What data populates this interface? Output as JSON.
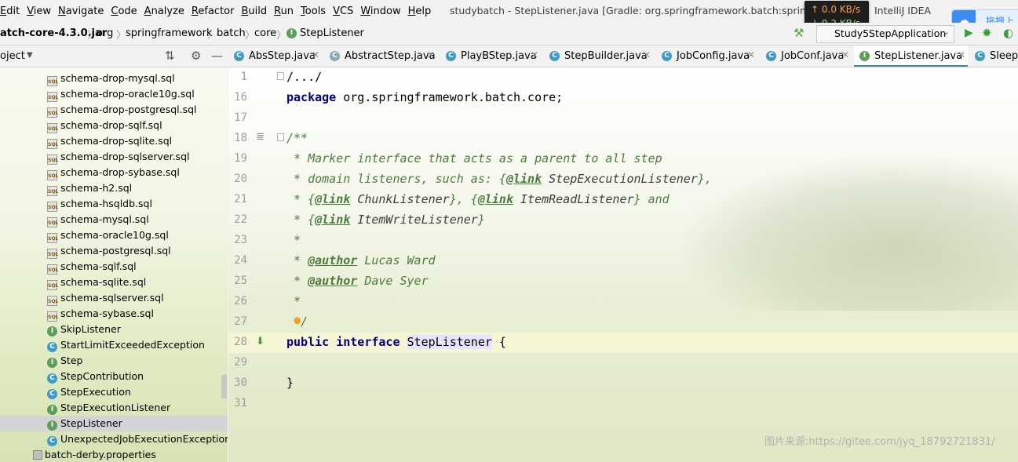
{
  "menu": [
    "Edit",
    "View",
    "Navigate",
    "Code",
    "Analyze",
    "Refactor",
    "Build",
    "Run",
    "Tools",
    "VCS",
    "Window",
    "Help"
  ],
  "window_title": "studybatch - StepListener.java [Gradle: org.springframework.batch:spring-batch",
  "app_name": "IntelliJ IDEA",
  "netspeed": {
    "up": "↑ 0.0 KB/s",
    "down": "↓ 0.2 KB/s"
  },
  "baidu_label": "拖拽上传",
  "breadcrumb": {
    "jar": "atch-core-4.3.0.jar",
    "items": [
      "org",
      "springframework",
      "batch",
      "core",
      "StepListener"
    ]
  },
  "run_config": "Study5StepApplication",
  "project_header": "oject",
  "tabs": [
    {
      "label": "AbsStep.java",
      "icon": "class"
    },
    {
      "label": "AbstractStep.java",
      "icon": "abstract-class"
    },
    {
      "label": "PlayBStep.java",
      "icon": "class"
    },
    {
      "label": "StepBuilder.java",
      "icon": "class"
    },
    {
      "label": "JobConfig.java",
      "icon": "class"
    },
    {
      "label": "JobConf.java",
      "icon": "class"
    },
    {
      "label": "StepListener.java",
      "icon": "interface"
    },
    {
      "label": "SleepS",
      "icon": "class"
    }
  ],
  "tree": [
    {
      "label": "schema-drop-mysql.sql",
      "icon": "sql"
    },
    {
      "label": "schema-drop-oracle10g.sql",
      "icon": "sql"
    },
    {
      "label": "schema-drop-postgresql.sql",
      "icon": "sql"
    },
    {
      "label": "schema-drop-sqlf.sql",
      "icon": "sql"
    },
    {
      "label": "schema-drop-sqlite.sql",
      "icon": "sql"
    },
    {
      "label": "schema-drop-sqlserver.sql",
      "icon": "sql"
    },
    {
      "label": "schema-drop-sybase.sql",
      "icon": "sql"
    },
    {
      "label": "schema-h2.sql",
      "icon": "sql"
    },
    {
      "label": "schema-hsqldb.sql",
      "icon": "sql"
    },
    {
      "label": "schema-mysql.sql",
      "icon": "sql"
    },
    {
      "label": "schema-oracle10g.sql",
      "icon": "sql"
    },
    {
      "label": "schema-postgresql.sql",
      "icon": "sql"
    },
    {
      "label": "schema-sqlf.sql",
      "icon": "sql"
    },
    {
      "label": "schema-sqlite.sql",
      "icon": "sql"
    },
    {
      "label": "schema-sqlserver.sql",
      "icon": "sql"
    },
    {
      "label": "schema-sybase.sql",
      "icon": "sql"
    },
    {
      "label": "SkipListener",
      "icon": "interface"
    },
    {
      "label": "StartLimitExceededException",
      "icon": "class"
    },
    {
      "label": "Step",
      "icon": "interface"
    },
    {
      "label": "StepContribution",
      "icon": "class"
    },
    {
      "label": "StepExecution",
      "icon": "class"
    },
    {
      "label": "StepExecutionListener",
      "icon": "interface"
    },
    {
      "label": "StepListener",
      "icon": "interface",
      "selected": true
    },
    {
      "label": "UnexpectedJobExecutionException",
      "icon": "class"
    },
    {
      "label": "batch-derby.properties",
      "icon": "properties"
    }
  ],
  "code_lines": [
    {
      "n": "1",
      "text": "/.../"
    },
    {
      "n": "16",
      "text": "package org.springframework.batch.core;"
    },
    {
      "n": "17",
      "text": ""
    },
    {
      "n": "18",
      "text": "/**"
    },
    {
      "n": "19",
      "text": " * Marker interface that acts as a parent to all step"
    },
    {
      "n": "20",
      "text": " * domain listeners, such as: {@link StepExecutionListener},"
    },
    {
      "n": "21",
      "text": " * {@link ChunkListener}, {@link ItemReadListener} and"
    },
    {
      "n": "22",
      "text": " * {@link ItemWriteListener}"
    },
    {
      "n": "23",
      "text": " *"
    },
    {
      "n": "24",
      "text": " * @author Lucas Ward"
    },
    {
      "n": "25",
      "text": " * @author Dave Syer"
    },
    {
      "n": "26",
      "text": " *"
    },
    {
      "n": "27",
      "text": " */"
    },
    {
      "n": "28",
      "text": "public interface StepListener {"
    },
    {
      "n": "29",
      "text": ""
    },
    {
      "n": "30",
      "text": "}"
    },
    {
      "n": "31",
      "text": ""
    }
  ],
  "watermark": "图片来源:https://gitee.com/jyq_18792721831/"
}
